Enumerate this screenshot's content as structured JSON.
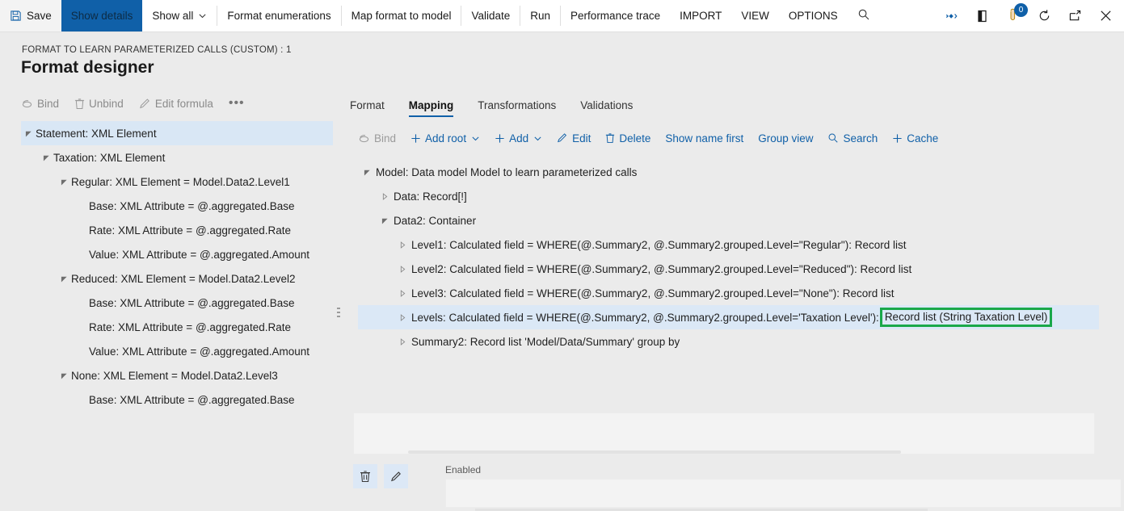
{
  "topbar": {
    "left_items": [
      {
        "label": "Save",
        "icon": "save-icon",
        "name": "save-button",
        "style": "icon"
      },
      {
        "label": "Show details",
        "icon": null,
        "name": "show-details-button",
        "style": "active"
      },
      {
        "label": "Show all",
        "icon": null,
        "name": "show-all-button",
        "style": "chevron"
      },
      {
        "label": "Format enumerations",
        "icon": null,
        "name": "format-enumerations-button",
        "style": "sep"
      },
      {
        "label": "Map format to model",
        "icon": null,
        "name": "map-format-to-model-button",
        "style": "sep"
      },
      {
        "label": "Validate",
        "icon": null,
        "name": "validate-button",
        "style": "sep"
      },
      {
        "label": "Run",
        "icon": null,
        "name": "run-button",
        "style": "plain"
      },
      {
        "label": "Performance trace",
        "icon": null,
        "name": "performance-trace-button",
        "style": "sep"
      },
      {
        "label": "IMPORT",
        "icon": null,
        "name": "import-menu",
        "style": "plain"
      },
      {
        "label": "VIEW",
        "icon": null,
        "name": "view-menu",
        "style": "plain"
      },
      {
        "label": "OPTIONS",
        "icon": null,
        "name": "options-menu",
        "style": "plain"
      }
    ],
    "search_icon": "search-icon",
    "right_icons": [
      {
        "name": "diamond-icon",
        "badge": null
      },
      {
        "name": "panel-icon",
        "badge": null
      },
      {
        "name": "notifications-icon",
        "badge": "0"
      },
      {
        "name": "refresh-icon",
        "badge": null
      },
      {
        "name": "popout-icon",
        "badge": null
      },
      {
        "name": "close-icon",
        "badge": null
      }
    ]
  },
  "header": {
    "breadcrumb": "FORMAT TO LEARN PARAMETERIZED CALLS (CUSTOM) : 1",
    "title": "Format designer"
  },
  "left_actions": [
    {
      "label": "Bind",
      "icon": "bind-icon",
      "name": "bind-button"
    },
    {
      "label": "Unbind",
      "icon": "trash-icon",
      "name": "unbind-button"
    },
    {
      "label": "Edit formula",
      "icon": "pencil-icon",
      "name": "edit-formula-button"
    },
    {
      "label": "•••",
      "icon": null,
      "name": "more-actions-button"
    }
  ],
  "format_tree": [
    {
      "label": "Statement: XML Element",
      "indent": 0,
      "twisty": "expanded",
      "selected": true
    },
    {
      "label": "Taxation: XML Element",
      "indent": 1,
      "twisty": "expanded",
      "selected": false
    },
    {
      "label": "Regular: XML Element = Model.Data2.Level1",
      "indent": 2,
      "twisty": "expanded",
      "selected": false
    },
    {
      "label": "Base: XML Attribute = @.aggregated.Base",
      "indent": 3,
      "twisty": "none",
      "selected": false
    },
    {
      "label": "Rate: XML Attribute = @.aggregated.Rate",
      "indent": 3,
      "twisty": "none",
      "selected": false
    },
    {
      "label": "Value: XML Attribute = @.aggregated.Amount",
      "indent": 3,
      "twisty": "none",
      "selected": false
    },
    {
      "label": "Reduced: XML Element = Model.Data2.Level2",
      "indent": 2,
      "twisty": "expanded",
      "selected": false
    },
    {
      "label": "Base: XML Attribute = @.aggregated.Base",
      "indent": 3,
      "twisty": "none",
      "selected": false
    },
    {
      "label": "Rate: XML Attribute = @.aggregated.Rate",
      "indent": 3,
      "twisty": "none",
      "selected": false
    },
    {
      "label": "Value: XML Attribute = @.aggregated.Amount",
      "indent": 3,
      "twisty": "none",
      "selected": false
    },
    {
      "label": "None: XML Element = Model.Data2.Level3",
      "indent": 2,
      "twisty": "expanded",
      "selected": false
    },
    {
      "label": "Base: XML Attribute = @.aggregated.Base",
      "indent": 3,
      "twisty": "none",
      "selected": false
    }
  ],
  "tabs": [
    {
      "label": "Format",
      "name": "tab-format",
      "active": false
    },
    {
      "label": "Mapping",
      "name": "tab-mapping",
      "active": true
    },
    {
      "label": "Transformations",
      "name": "tab-transformations",
      "active": false
    },
    {
      "label": "Validations",
      "name": "tab-validations",
      "active": false
    }
  ],
  "mapping_toolbar": [
    {
      "label": "Bind",
      "icon": "bind-icon",
      "name": "mapping-bind-button",
      "disabled": true,
      "chevron": false
    },
    {
      "label": "Add root",
      "icon": "plus-icon",
      "name": "add-root-button",
      "disabled": false,
      "chevron": true
    },
    {
      "label": "Add",
      "icon": "plus-icon",
      "name": "add-button",
      "disabled": false,
      "chevron": true
    },
    {
      "label": "Edit",
      "icon": "pencil-icon",
      "name": "edit-button",
      "disabled": false,
      "chevron": false
    },
    {
      "label": "Delete",
      "icon": "trash-icon",
      "name": "delete-button",
      "disabled": false,
      "chevron": false
    },
    {
      "label": "Show name first",
      "icon": null,
      "name": "show-name-first-button",
      "disabled": false,
      "chevron": false
    },
    {
      "label": "Group view",
      "icon": null,
      "name": "group-view-button",
      "disabled": false,
      "chevron": false
    },
    {
      "label": "Search",
      "icon": "search-icon",
      "name": "mapping-search-button",
      "disabled": false,
      "chevron": false
    },
    {
      "label": "Cache",
      "icon": "plus-icon",
      "name": "cache-button",
      "disabled": false,
      "chevron": false
    }
  ],
  "mapping_tree": [
    {
      "label": "Model: Data model Model to learn parameterized calls",
      "indent": 0,
      "twisty": "expanded",
      "selected": false,
      "highlight": null
    },
    {
      "label": "Data: Record[!]",
      "indent": 1,
      "twisty": "collapsed",
      "selected": false,
      "highlight": null
    },
    {
      "label": "Data2: Container",
      "indent": 1,
      "twisty": "expanded",
      "selected": false,
      "highlight": null
    },
    {
      "label": "Level1: Calculated field = WHERE(@.Summary2, @.Summary2.grouped.Level=\"Regular\"): Record list",
      "indent": 2,
      "twisty": "collapsed",
      "selected": false,
      "highlight": null
    },
    {
      "label": "Level2: Calculated field = WHERE(@.Summary2, @.Summary2.grouped.Level=\"Reduced\"): Record list",
      "indent": 2,
      "twisty": "collapsed",
      "selected": false,
      "highlight": null
    },
    {
      "label": "Level3: Calculated field = WHERE(@.Summary2, @.Summary2.grouped.Level=\"None\"): Record list",
      "indent": 2,
      "twisty": "collapsed",
      "selected": false,
      "highlight": null
    },
    {
      "label": "Levels: Calculated field = WHERE(@.Summary2, @.Summary2.grouped.Level='Taxation Level'): ",
      "indent": 2,
      "twisty": "collapsed",
      "selected": true,
      "highlight": "Record list (String Taxation Level)"
    },
    {
      "label": "Summary2: Record list 'Model/Data/Summary' group by",
      "indent": 2,
      "twisty": "collapsed",
      "selected": false,
      "highlight": null
    }
  ],
  "bottom": {
    "delete_icon": "trash-icon",
    "edit_icon": "pencil-icon",
    "field_label": "Enabled",
    "field_value": ""
  },
  "colors": {
    "accent": "#1060a8",
    "highlight_border": "#1aa84a",
    "selection": "#dbe8f6",
    "page_bg": "#ebebeb"
  }
}
